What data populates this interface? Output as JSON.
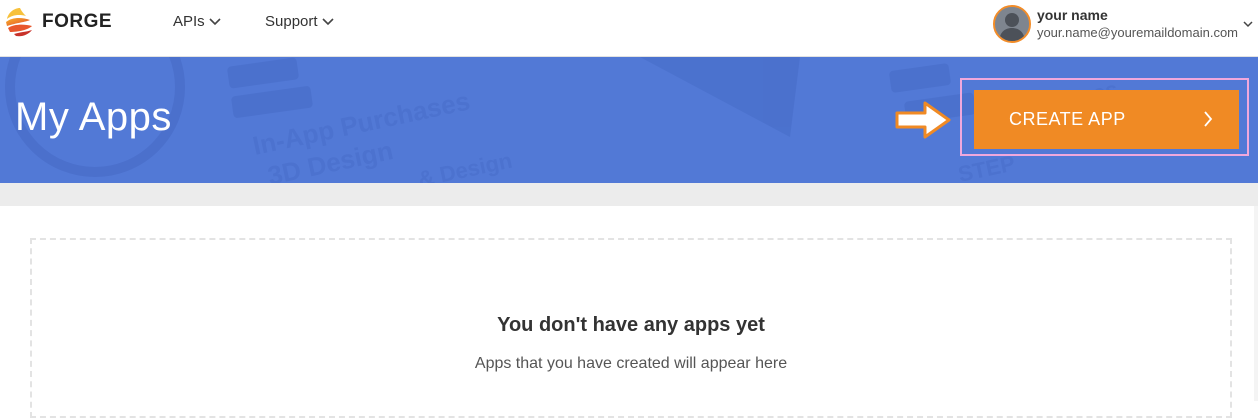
{
  "brand": {
    "name": "FORGE",
    "logo_icon": "forge-logo-icon"
  },
  "nav": {
    "items": [
      {
        "label": "APIs",
        "icon": "chevron-down-icon"
      },
      {
        "label": "Support",
        "icon": "chevron-down-icon"
      }
    ]
  },
  "user": {
    "name": "your name",
    "email": "your.name@youremaildomain.com",
    "avatar_icon": "user-avatar-icon",
    "menu_icon": "chevron-down-icon"
  },
  "banner": {
    "title": "My Apps",
    "create_button": {
      "label": "CREATE APP",
      "icon": "chevron-right-icon"
    },
    "pointer_icon": "arrow-right-outline-icon",
    "colors": {
      "background": "#5279d6",
      "button": "#f08a24",
      "highlight": "#f0a8dc"
    }
  },
  "empty_state": {
    "title": "You don't have any apps yet",
    "subtitle": "Apps that you have created will appear here"
  }
}
